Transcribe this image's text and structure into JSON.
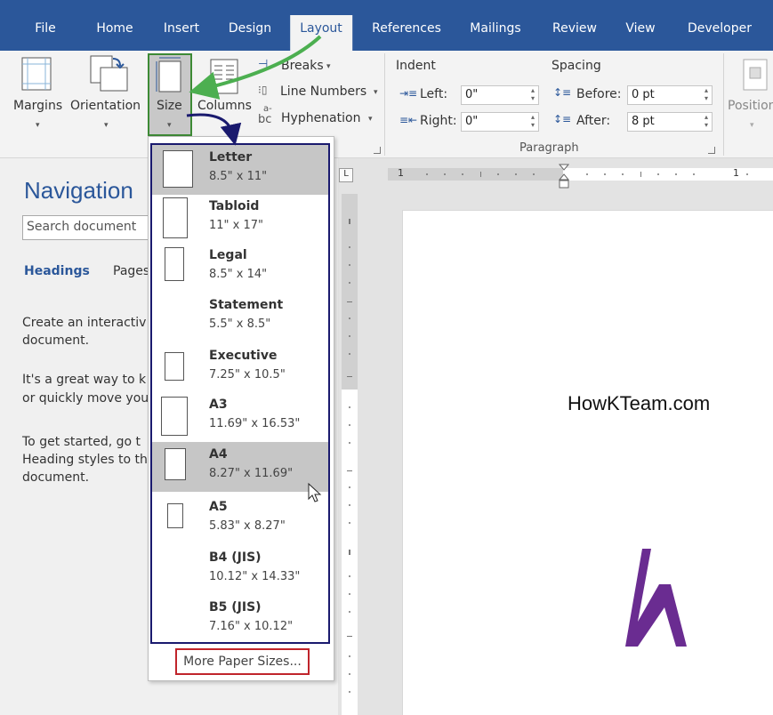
{
  "colors": {
    "ribbon_blue": "#2b579a",
    "logo_purple": "#6a2c91",
    "green_arrow": "#4caf50",
    "navy_arrow": "#1a1a6e",
    "red_outline": "#c0242b"
  },
  "tabs": [
    "File",
    "Home",
    "Insert",
    "Design",
    "Layout",
    "References",
    "Mailings",
    "Review",
    "View",
    "Developer"
  ],
  "ribbon": {
    "margins": "Margins",
    "orientation": "Orientation",
    "size": "Size",
    "columns": "Columns",
    "breaks": "Breaks",
    "line_numbers": "Line Numbers",
    "hyphenation": "Hyphenation",
    "hyphen_glyph": "bc",
    "hyphen_glyph_top": "a-",
    "indent": "Indent",
    "left": "Left:",
    "right": "Right:",
    "left_value": "0\"",
    "right_value": "0\"",
    "spacing": "Spacing",
    "before": "Before:",
    "after": "After:",
    "before_value": "0 pt",
    "after_value": "8 pt",
    "paragraph": "Paragraph",
    "position": "Position"
  },
  "navigation": {
    "title": "Navigation",
    "search_placeholder": "Search document",
    "tab_headings": "Headings",
    "tab_pages": "Pages",
    "lines": [
      "Create an interactiv",
      "document.",
      "It's a great way to k",
      "or quickly move you",
      "To get started, go t",
      "Heading styles to th",
      "document."
    ]
  },
  "ruler": {
    "corner": "L",
    "mark_1": "1",
    "mark_right": "1"
  },
  "paper_sizes": [
    {
      "name": "Letter",
      "dims": "8.5\" x 11\""
    },
    {
      "name": "Tabloid",
      "dims": "11\" x 17\""
    },
    {
      "name": "Legal",
      "dims": "8.5\" x 14\""
    },
    {
      "name": "Statement",
      "dims": "5.5\" x 8.5\""
    },
    {
      "name": "Executive",
      "dims": "7.25\" x 10.5\""
    },
    {
      "name": "A3",
      "dims": "11.69\" x 16.53\""
    },
    {
      "name": "A4",
      "dims": "8.27\" x 11.69\""
    },
    {
      "name": "A5",
      "dims": "5.83\" x 8.27\""
    },
    {
      "name": "B4 (JIS)",
      "dims": "10.12\" x 14.33\""
    },
    {
      "name": "B5 (JIS)",
      "dims": "7.16\" x 10.12\""
    }
  ],
  "more_sizes": "More Paper Sizes...",
  "document": {
    "watermark": "HowKTeam.com"
  }
}
